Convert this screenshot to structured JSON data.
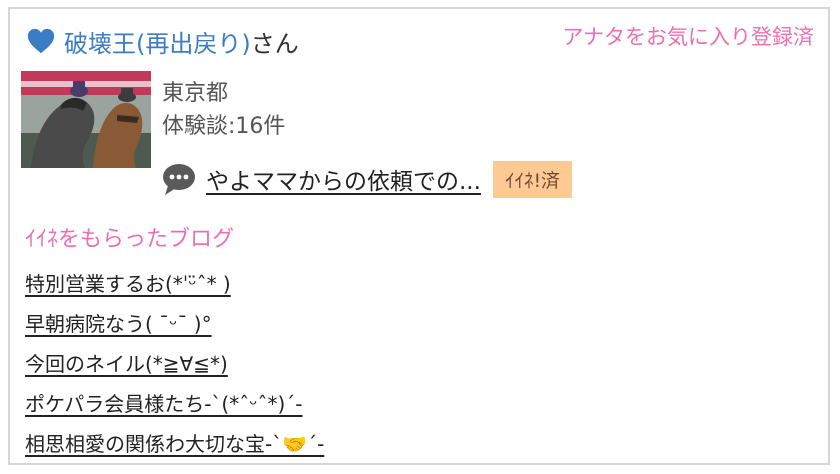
{
  "user": {
    "name": "破壊王(再出戻り)",
    "suffix": "さん",
    "location": "東京都",
    "experience": "体験談:16件",
    "favorite_status": "アナタをお気に入り登録済",
    "heart_icon": "heart-icon",
    "heart_color": "#3b7dc4"
  },
  "review": {
    "icon": "speech-bubble-icon",
    "text": "やよママからの依頼での...",
    "badge": "ｲｲﾈ!済",
    "badge_color": "#ffc994"
  },
  "blogs": {
    "title": "ｲｲﾈをもらったブログ",
    "items": [
      "特別営業するお(*ˈᵕ̈ˆ* )",
      "早朝病院なう( ˉᵕˉ )°",
      "今回のネイル(*≧∀≦*)",
      "ポケパラ会員様たち-ˋ(*ˆᵕˆ*)ˊ-",
      "相思相愛の関係わ大切な宝-ˋ🤝ˊ-"
    ]
  },
  "colors": {
    "accent_pink": "#ec6fb1",
    "link_blue": "#3b7dc4",
    "border": "#d6d6d6"
  }
}
